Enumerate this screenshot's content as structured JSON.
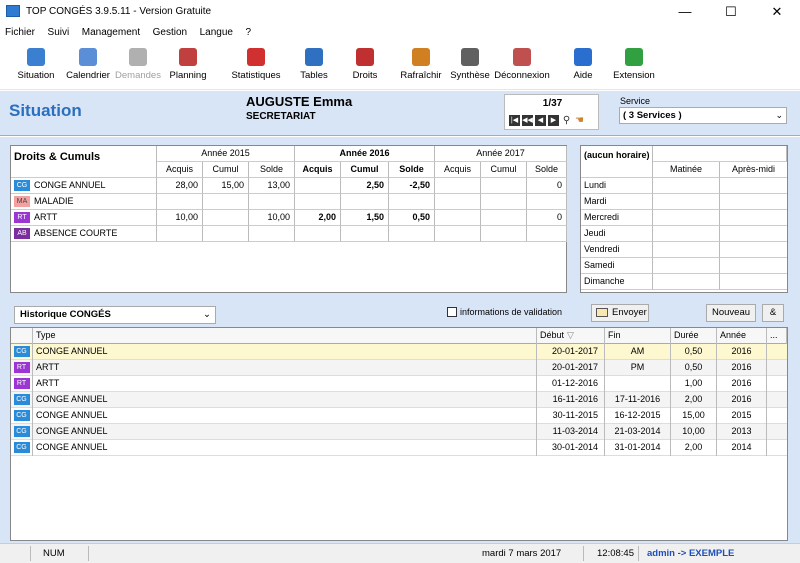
{
  "window": {
    "title": "TOP CONGÉS 3.9.5.11 - Version Gratuite",
    "minimize": "—",
    "maximize": "☐",
    "close": "✕"
  },
  "menu": [
    "Fichier",
    "Suivi",
    "Management",
    "Gestion",
    "Langue",
    "?"
  ],
  "toolbar": [
    {
      "label": "Situation",
      "icon": "situation-icon",
      "color": "#3a7fd0",
      "enabled": true
    },
    {
      "label": "Calendrier",
      "icon": "calendar-icon",
      "color": "#5a8fd8",
      "enabled": true
    },
    {
      "label": "Demandes",
      "icon": "requests-icon",
      "color": "#b0b0b0",
      "enabled": false
    },
    {
      "label": "Planning",
      "icon": "planning-icon",
      "color": "#c04040",
      "enabled": true
    },
    {
      "label": "Statistiques",
      "icon": "stats-icon",
      "color": "#d03030",
      "enabled": true
    },
    {
      "label": "Tables",
      "icon": "tables-icon",
      "color": "#3070c0",
      "enabled": true
    },
    {
      "label": "Droits",
      "icon": "rights-icon",
      "color": "#c03030",
      "enabled": true
    },
    {
      "label": "Rafraîchir",
      "icon": "refresh-icon",
      "color": "#d08020",
      "enabled": true
    },
    {
      "label": "Synthèse",
      "icon": "synthesis-icon",
      "color": "#606060",
      "enabled": true
    },
    {
      "label": "Déconnexion",
      "icon": "logout-icon",
      "color": "#c05050",
      "enabled": true
    },
    {
      "label": "Aide",
      "icon": "help-icon",
      "color": "#2a6fd0",
      "enabled": true
    },
    {
      "label": "Extension",
      "icon": "extension-icon",
      "color": "#30a040",
      "enabled": true
    }
  ],
  "header": {
    "section_title": "Situation",
    "employee_name": "AUGUSTE Emma",
    "employee_dept": "SECRETARIAT",
    "nav_counter": "1/37",
    "service_label": "Service",
    "service_value": "( 3 Services )"
  },
  "rights": {
    "title": "Droits & Cumuls",
    "years": [
      "Année 2015",
      "Année 2016",
      "Année 2017"
    ],
    "subcols": [
      "Acquis",
      "Cumul",
      "Solde"
    ],
    "rows": [
      {
        "badge": "CG",
        "badge_color": "#2a8bd8",
        "label": "CONGE ANNUEL",
        "v": [
          "28,00",
          "15,00",
          "13,00",
          "",
          "2,50",
          "-2,50",
          "",
          "",
          "0"
        ]
      },
      {
        "badge": "MA",
        "badge_color": "#f3a0a0",
        "label": "MALADIE",
        "v": [
          "",
          "",
          "",
          "",
          "",
          "",
          "",
          "",
          ""
        ]
      },
      {
        "badge": "RT",
        "badge_color": "#9b36d3",
        "label": "ARTT",
        "v": [
          "10,00",
          "",
          "10,00",
          "2,00",
          "1,50",
          "0,50",
          "",
          "",
          "0"
        ]
      },
      {
        "badge": "AB",
        "badge_color": "#7b2e9e",
        "label": "ABSENCE COURTE",
        "v": [
          "",
          "",
          "",
          "",
          "",
          "",
          "",
          "",
          ""
        ]
      }
    ]
  },
  "schedule": {
    "title": "(aucun horaire)",
    "cols": [
      "Matinée",
      "Après-midi"
    ],
    "days": [
      "Lundi",
      "Mardi",
      "Mercredi",
      "Jeudi",
      "Vendredi",
      "Samedi",
      "Dimanche"
    ]
  },
  "history": {
    "selector": "Historique CONGÉS",
    "validation_label": "informations de validation",
    "send_label": "Envoyer",
    "new_label": "Nouveau",
    "amp_label": "&",
    "columns": [
      "Type",
      "Début",
      "Fin",
      "Durée",
      "Année",
      "..."
    ],
    "rows": [
      {
        "badge": "CG",
        "badge_color": "#2a8bd8",
        "type": "CONGE ANNUEL",
        "debut": "20-01-2017",
        "fin": "AM",
        "duree": "0,50",
        "annee": "2016",
        "selected": true
      },
      {
        "badge": "RT",
        "badge_color": "#9b36d3",
        "type": "ARTT",
        "debut": "20-01-2017",
        "fin": "PM",
        "duree": "0,50",
        "annee": "2016",
        "selected": false
      },
      {
        "badge": "RT",
        "badge_color": "#9b36d3",
        "type": "ARTT",
        "debut": "01-12-2016",
        "fin": "",
        "duree": "1,00",
        "annee": "2016",
        "selected": false
      },
      {
        "badge": "CG",
        "badge_color": "#2a8bd8",
        "type": "CONGE ANNUEL",
        "debut": "16-11-2016",
        "fin": "17-11-2016",
        "duree": "2,00",
        "annee": "2016",
        "selected": false
      },
      {
        "badge": "CG",
        "badge_color": "#2a8bd8",
        "type": "CONGE ANNUEL",
        "debut": "30-11-2015",
        "fin": "16-12-2015",
        "duree": "15,00",
        "annee": "2015",
        "selected": false
      },
      {
        "badge": "CG",
        "badge_color": "#2a8bd8",
        "type": "CONGE ANNUEL",
        "debut": "11-03-2014",
        "fin": "21-03-2014",
        "duree": "10,00",
        "annee": "2013",
        "selected": false
      },
      {
        "badge": "CG",
        "badge_color": "#2a8bd8",
        "type": "CONGE ANNUEL",
        "debut": "30-01-2014",
        "fin": "31-01-2014",
        "duree": "2,00",
        "annee": "2014",
        "selected": false
      }
    ]
  },
  "status": {
    "num": "NUM",
    "date": "mardi 7 mars 2017",
    "time": "12:08:45",
    "user": "admin -> EXEMPLE"
  }
}
